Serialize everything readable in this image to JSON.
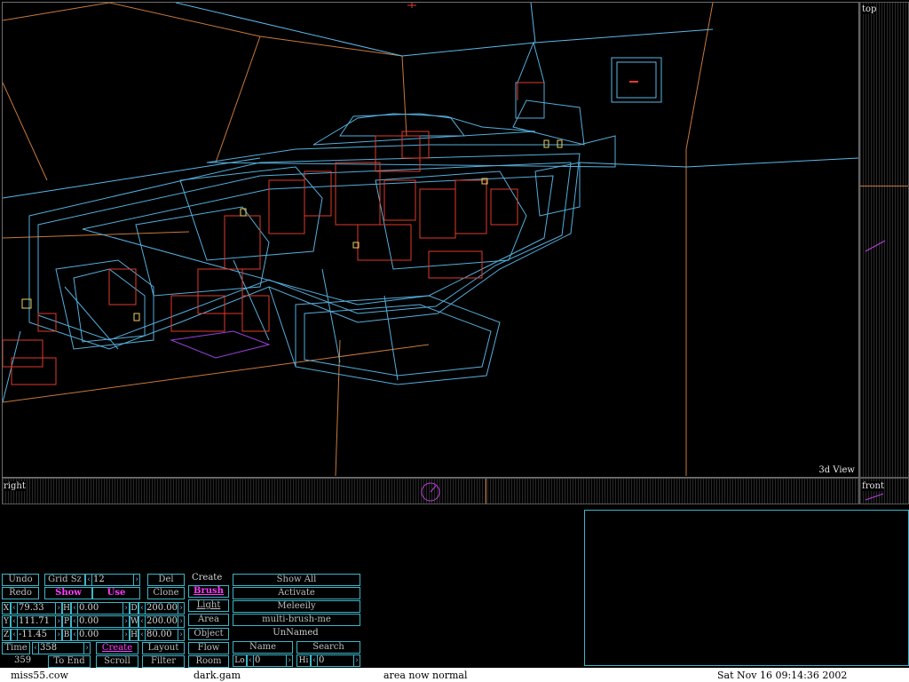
{
  "viewport": {
    "label_3d": "3d View",
    "label_top": "top",
    "label_right": "right",
    "label_front": "front"
  },
  "controls": {
    "undo": "Undo",
    "redo": "Redo",
    "grid_sz_label": "Grid Sz",
    "grid_sz_value": "12",
    "show": "Show",
    "use": "Use",
    "del": "Del",
    "clone": "Clone",
    "x_label": "X",
    "x_value": "79.33",
    "y_label": "Y",
    "y_value": "111.71",
    "z_label": "Z",
    "z_value": "-11.45",
    "h_label": "H",
    "h_value": "0.00",
    "p_label": "P",
    "p_value": "0.00",
    "b_label": "B",
    "b_value": "0.00",
    "d_label": "D",
    "d_value": "200.00",
    "w_label": "W",
    "w_value": "200.00",
    "hh_label": "H",
    "hh_value": "80.00",
    "time_label": "Time",
    "time_value": "358",
    "time_sub": "359",
    "to_end": "To End",
    "create_bottom": "Create",
    "scroll": "Scroll",
    "layout": "Layout",
    "filter": "Filter",
    "mode_create": "Create",
    "mode_brush": "Brush",
    "mode_light": "Light",
    "mode_area": "Area",
    "mode_object": "Object",
    "mode_flow": "Flow",
    "mode_room": "Room",
    "show_all": "Show All",
    "activate": "Activate",
    "meleely": "Meleeily",
    "multi_brush": "multi-brush-me",
    "unnamed": "UnNamed",
    "name": "Name",
    "search": "Search",
    "lo_label": "Lo",
    "lo_value": "0",
    "hi_label": "Hi",
    "hi_value": "0"
  },
  "statusbar": {
    "mission": "miss55.cow",
    "gamesys": "dark.gam",
    "message": "area now normal",
    "datetime": "Sat Nov 16 09:14:36 2002"
  },
  "colors": {
    "brush_outline": "#5ab8e8",
    "object_outline": "#e03a2a",
    "room_outline": "#d08040",
    "accent": "#3bb6c8",
    "highlight": "#ff3cff"
  }
}
